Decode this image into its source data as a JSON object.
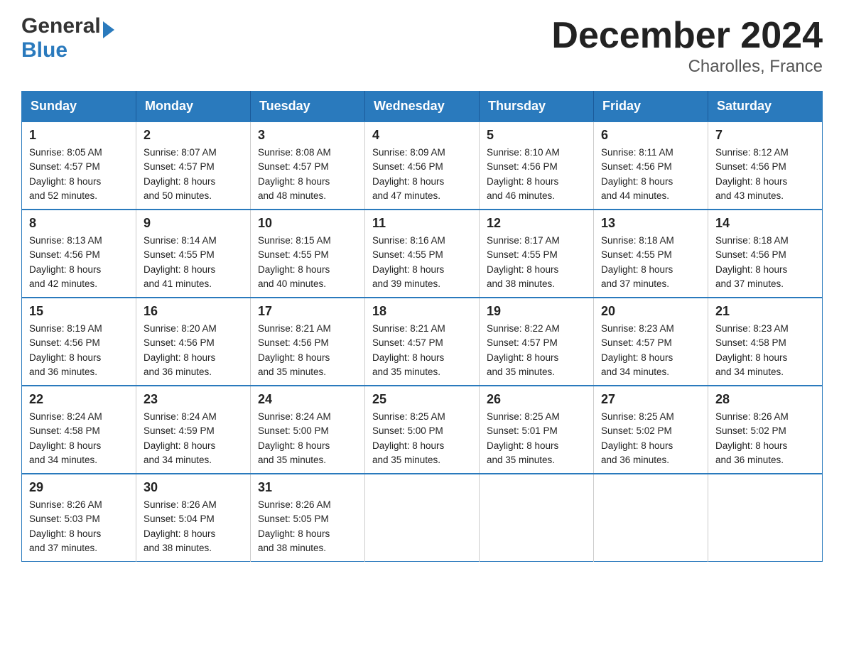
{
  "header": {
    "logo_line1": "General",
    "logo_line2": "Blue",
    "title": "December 2024",
    "subtitle": "Charolles, France"
  },
  "days_of_week": [
    "Sunday",
    "Monday",
    "Tuesday",
    "Wednesday",
    "Thursday",
    "Friday",
    "Saturday"
  ],
  "weeks": [
    [
      {
        "day": "1",
        "sunrise": "Sunrise: 8:05 AM",
        "sunset": "Sunset: 4:57 PM",
        "daylight": "Daylight: 8 hours and 52 minutes."
      },
      {
        "day": "2",
        "sunrise": "Sunrise: 8:07 AM",
        "sunset": "Sunset: 4:57 PM",
        "daylight": "Daylight: 8 hours and 50 minutes."
      },
      {
        "day": "3",
        "sunrise": "Sunrise: 8:08 AM",
        "sunset": "Sunset: 4:57 PM",
        "daylight": "Daylight: 8 hours and 48 minutes."
      },
      {
        "day": "4",
        "sunrise": "Sunrise: 8:09 AM",
        "sunset": "Sunset: 4:56 PM",
        "daylight": "Daylight: 8 hours and 47 minutes."
      },
      {
        "day": "5",
        "sunrise": "Sunrise: 8:10 AM",
        "sunset": "Sunset: 4:56 PM",
        "daylight": "Daylight: 8 hours and 46 minutes."
      },
      {
        "day": "6",
        "sunrise": "Sunrise: 8:11 AM",
        "sunset": "Sunset: 4:56 PM",
        "daylight": "Daylight: 8 hours and 44 minutes."
      },
      {
        "day": "7",
        "sunrise": "Sunrise: 8:12 AM",
        "sunset": "Sunset: 4:56 PM",
        "daylight": "Daylight: 8 hours and 43 minutes."
      }
    ],
    [
      {
        "day": "8",
        "sunrise": "Sunrise: 8:13 AM",
        "sunset": "Sunset: 4:56 PM",
        "daylight": "Daylight: 8 hours and 42 minutes."
      },
      {
        "day": "9",
        "sunrise": "Sunrise: 8:14 AM",
        "sunset": "Sunset: 4:55 PM",
        "daylight": "Daylight: 8 hours and 41 minutes."
      },
      {
        "day": "10",
        "sunrise": "Sunrise: 8:15 AM",
        "sunset": "Sunset: 4:55 PM",
        "daylight": "Daylight: 8 hours and 40 minutes."
      },
      {
        "day": "11",
        "sunrise": "Sunrise: 8:16 AM",
        "sunset": "Sunset: 4:55 PM",
        "daylight": "Daylight: 8 hours and 39 minutes."
      },
      {
        "day": "12",
        "sunrise": "Sunrise: 8:17 AM",
        "sunset": "Sunset: 4:55 PM",
        "daylight": "Daylight: 8 hours and 38 minutes."
      },
      {
        "day": "13",
        "sunrise": "Sunrise: 8:18 AM",
        "sunset": "Sunset: 4:55 PM",
        "daylight": "Daylight: 8 hours and 37 minutes."
      },
      {
        "day": "14",
        "sunrise": "Sunrise: 8:18 AM",
        "sunset": "Sunset: 4:56 PM",
        "daylight": "Daylight: 8 hours and 37 minutes."
      }
    ],
    [
      {
        "day": "15",
        "sunrise": "Sunrise: 8:19 AM",
        "sunset": "Sunset: 4:56 PM",
        "daylight": "Daylight: 8 hours and 36 minutes."
      },
      {
        "day": "16",
        "sunrise": "Sunrise: 8:20 AM",
        "sunset": "Sunset: 4:56 PM",
        "daylight": "Daylight: 8 hours and 36 minutes."
      },
      {
        "day": "17",
        "sunrise": "Sunrise: 8:21 AM",
        "sunset": "Sunset: 4:56 PM",
        "daylight": "Daylight: 8 hours and 35 minutes."
      },
      {
        "day": "18",
        "sunrise": "Sunrise: 8:21 AM",
        "sunset": "Sunset: 4:57 PM",
        "daylight": "Daylight: 8 hours and 35 minutes."
      },
      {
        "day": "19",
        "sunrise": "Sunrise: 8:22 AM",
        "sunset": "Sunset: 4:57 PM",
        "daylight": "Daylight: 8 hours and 35 minutes."
      },
      {
        "day": "20",
        "sunrise": "Sunrise: 8:23 AM",
        "sunset": "Sunset: 4:57 PM",
        "daylight": "Daylight: 8 hours and 34 minutes."
      },
      {
        "day": "21",
        "sunrise": "Sunrise: 8:23 AM",
        "sunset": "Sunset: 4:58 PM",
        "daylight": "Daylight: 8 hours and 34 minutes."
      }
    ],
    [
      {
        "day": "22",
        "sunrise": "Sunrise: 8:24 AM",
        "sunset": "Sunset: 4:58 PM",
        "daylight": "Daylight: 8 hours and 34 minutes."
      },
      {
        "day": "23",
        "sunrise": "Sunrise: 8:24 AM",
        "sunset": "Sunset: 4:59 PM",
        "daylight": "Daylight: 8 hours and 34 minutes."
      },
      {
        "day": "24",
        "sunrise": "Sunrise: 8:24 AM",
        "sunset": "Sunset: 5:00 PM",
        "daylight": "Daylight: 8 hours and 35 minutes."
      },
      {
        "day": "25",
        "sunrise": "Sunrise: 8:25 AM",
        "sunset": "Sunset: 5:00 PM",
        "daylight": "Daylight: 8 hours and 35 minutes."
      },
      {
        "day": "26",
        "sunrise": "Sunrise: 8:25 AM",
        "sunset": "Sunset: 5:01 PM",
        "daylight": "Daylight: 8 hours and 35 minutes."
      },
      {
        "day": "27",
        "sunrise": "Sunrise: 8:25 AM",
        "sunset": "Sunset: 5:02 PM",
        "daylight": "Daylight: 8 hours and 36 minutes."
      },
      {
        "day": "28",
        "sunrise": "Sunrise: 8:26 AM",
        "sunset": "Sunset: 5:02 PM",
        "daylight": "Daylight: 8 hours and 36 minutes."
      }
    ],
    [
      {
        "day": "29",
        "sunrise": "Sunrise: 8:26 AM",
        "sunset": "Sunset: 5:03 PM",
        "daylight": "Daylight: 8 hours and 37 minutes."
      },
      {
        "day": "30",
        "sunrise": "Sunrise: 8:26 AM",
        "sunset": "Sunset: 5:04 PM",
        "daylight": "Daylight: 8 hours and 38 minutes."
      },
      {
        "day": "31",
        "sunrise": "Sunrise: 8:26 AM",
        "sunset": "Sunset: 5:05 PM",
        "daylight": "Daylight: 8 hours and 38 minutes."
      },
      {
        "day": "",
        "sunrise": "",
        "sunset": "",
        "daylight": ""
      },
      {
        "day": "",
        "sunrise": "",
        "sunset": "",
        "daylight": ""
      },
      {
        "day": "",
        "sunrise": "",
        "sunset": "",
        "daylight": ""
      },
      {
        "day": "",
        "sunrise": "",
        "sunset": "",
        "daylight": ""
      }
    ]
  ]
}
